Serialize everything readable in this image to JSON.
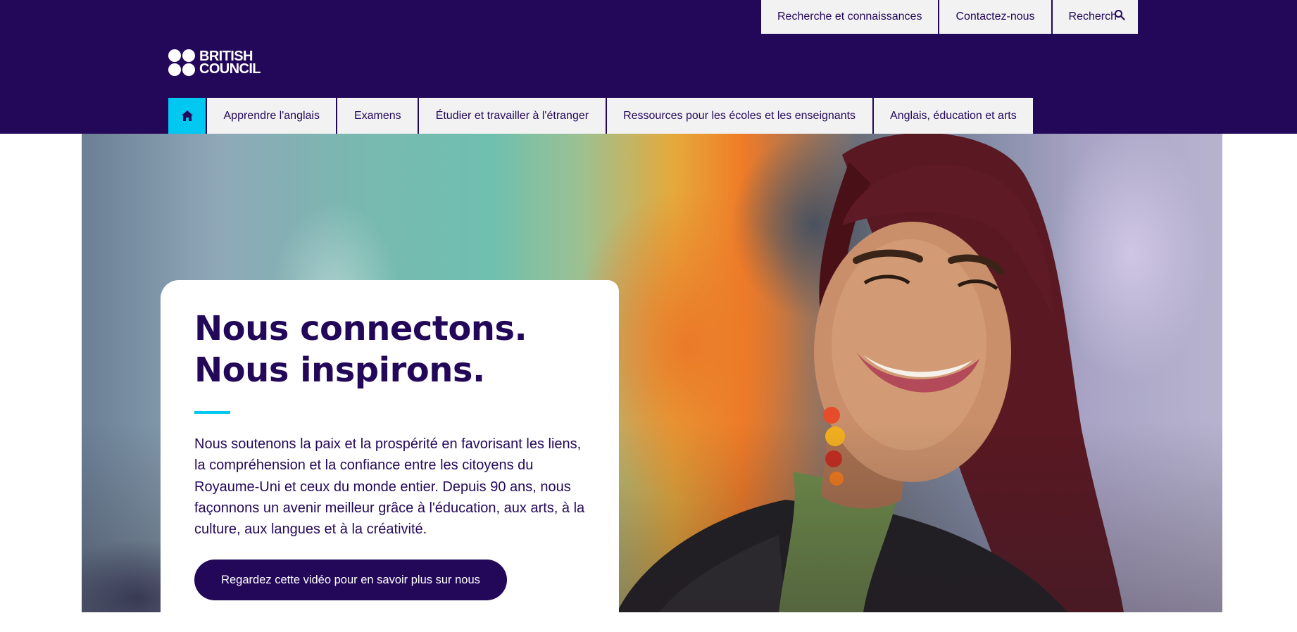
{
  "header": {
    "logo": {
      "line1": "BRITISH",
      "line2": "COUNCIL"
    },
    "utility_links": [
      {
        "label": "Recherche et connaissances"
      },
      {
        "label": "Contactez-nous"
      },
      {
        "label": "Recherch",
        "icon": "search-icon"
      }
    ],
    "main_nav": {
      "home_icon": "home-icon",
      "items": [
        {
          "label": "Apprendre l'anglais"
        },
        {
          "label": "Examens"
        },
        {
          "label": "Étudier et travailler à l'étranger"
        },
        {
          "label": "Ressources pour les écoles et les enseignants"
        },
        {
          "label": "Anglais, éducation et arts"
        }
      ]
    }
  },
  "hero": {
    "title_line1": "Nous connectons.",
    "title_line2": "Nous inspirons.",
    "body": "Nous soutenons la paix et la prospérité en favorisant les liens, la compréhension et la confiance entre les citoyens du Royaume-Uni et ceux du monde entier. Depuis 90 ans, nous façonnons un avenir meilleur grâce à l'éducation, aux arts, à la culture, aux langues et à la créativité.",
    "button_label": "Regardez cette vidéo pour en savoir plus sur nous"
  },
  "colors": {
    "brand_purple": "#23085a",
    "accent_cyan": "#00c8f0",
    "nav_bg": "#f2f2f2"
  }
}
